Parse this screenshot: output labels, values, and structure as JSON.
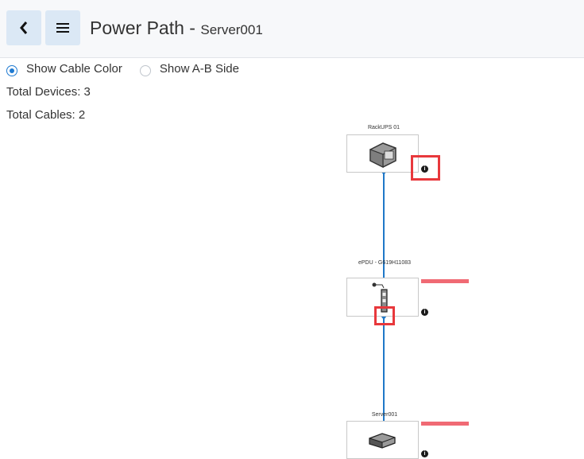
{
  "header": {
    "title": "Power Path",
    "separator": " - ",
    "subtitle": "Server001",
    "back_icon": "chevron-left-icon",
    "menu_icon": "hamburger-menu-icon"
  },
  "options": {
    "show_cable_color": "Show Cable Color",
    "show_ab_side": "Show A-B Side",
    "selected": "show_cable_color"
  },
  "stats": {
    "total_devices": "Total Devices: 3",
    "total_cables": "Total Cables: 2"
  },
  "diagram": {
    "cable_color": "#1f78c8",
    "highlight_color": "#e8383c",
    "devices": [
      {
        "label": "RackUPS 01",
        "icon": "ups-icon",
        "info": "i"
      },
      {
        "label": "ePDU - G619H11083",
        "icon": "pdu-icon",
        "info": "i"
      },
      {
        "label": "Server001",
        "icon": "server-icon",
        "info": "i"
      }
    ]
  }
}
